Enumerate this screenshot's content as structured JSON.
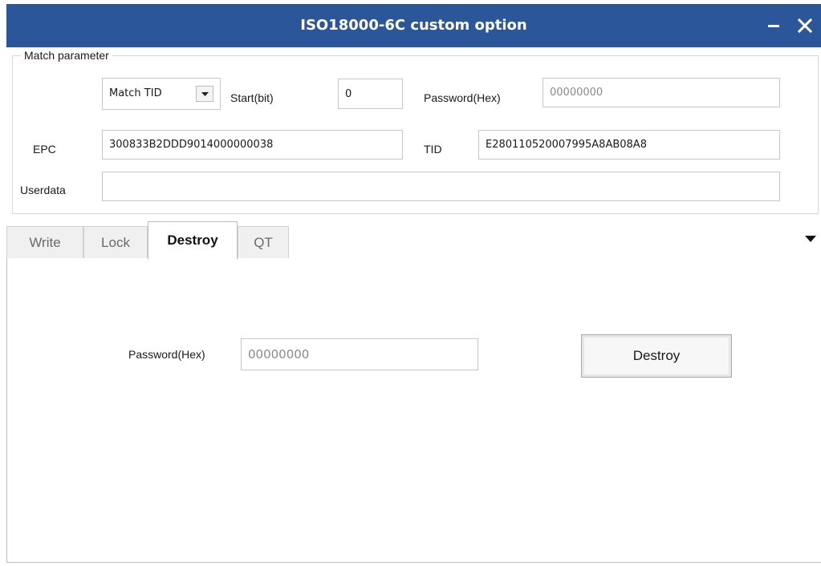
{
  "window": {
    "title": "ISO18000-6C custom option",
    "minimize_icon": "minimize-icon",
    "close_icon": "close-icon",
    "accent_color": "#2b579a"
  },
  "match_parameter": {
    "legend": "Match parameter",
    "match_select": {
      "value": "Match TID",
      "icon": "chevron-down-icon"
    },
    "start_bit": {
      "label": "Start(bit)",
      "value": "0"
    },
    "password": {
      "label": "Password(Hex)",
      "placeholder": "00000000"
    },
    "epc": {
      "label": "EPC",
      "value": "300833B2DDD9014000000038"
    },
    "tid": {
      "label": "TID",
      "value": "E280110520007995A8AB08A8"
    },
    "userdata": {
      "label": "Userdata",
      "value": ""
    }
  },
  "tabs": {
    "items": [
      {
        "label": "Write"
      },
      {
        "label": "Lock"
      },
      {
        "label": "Destroy"
      },
      {
        "label": "QT"
      }
    ],
    "active": "Destroy",
    "menu_icon": "triangle-down-icon"
  },
  "destroy_page": {
    "password": {
      "label": "Password(Hex)",
      "placeholder": "00000000"
    },
    "destroy_button": "Destroy"
  }
}
